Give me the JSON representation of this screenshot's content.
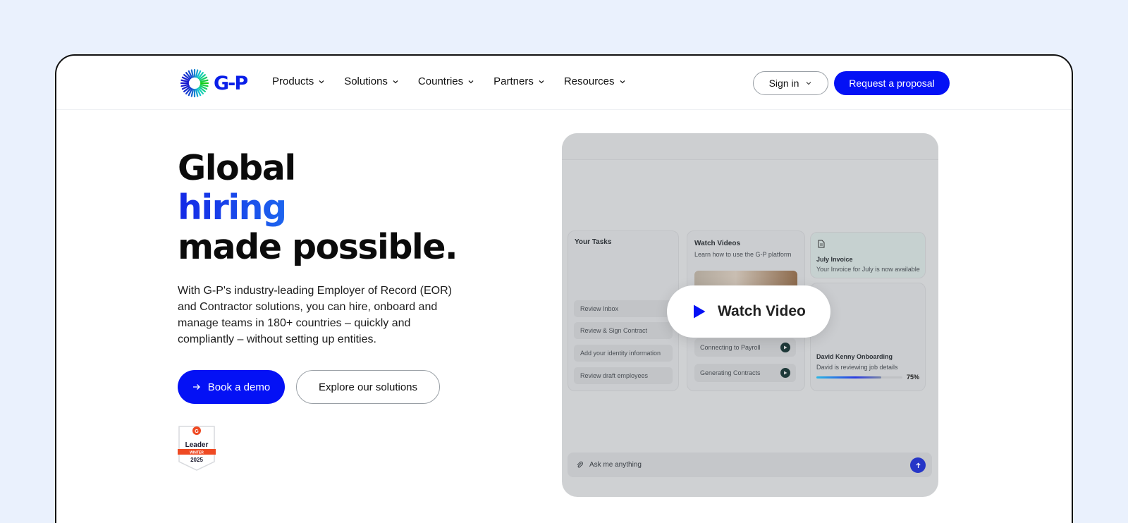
{
  "colors": {
    "brand": "#0411f5",
    "page_bg": "#eaf1fd",
    "text": "#111111"
  },
  "header": {
    "logo_text": "G-P",
    "nav": [
      {
        "label": "Products",
        "icon": "chevron-down-icon"
      },
      {
        "label": "Solutions",
        "icon": "chevron-down-icon"
      },
      {
        "label": "Countries",
        "icon": "chevron-down-icon"
      },
      {
        "label": "Partners",
        "icon": "chevron-down-icon"
      },
      {
        "label": "Resources",
        "icon": "chevron-down-icon"
      }
    ],
    "sign_in": "Sign in",
    "request_proposal": "Request a proposal"
  },
  "hero": {
    "headline_line1": "Global",
    "headline_line2": "hiring",
    "headline_line3": "made possible.",
    "description": "With G-P's industry-leading Employer of Record (EOR) and Contractor solutions, you can hire, onboard and manage teams in 180+ countries – quickly and compliantly – without setting up entities.",
    "book_demo": "Book a demo",
    "explore": "Explore our solutions",
    "badge": {
      "title": "Leader",
      "season": "WINTER",
      "year": "2025"
    }
  },
  "video_panel": {
    "tasks": {
      "title": "Your Tasks",
      "items": [
        "Review Inbox",
        "Review & Sign Contract",
        "Add your identity information",
        "Review draft employees"
      ]
    },
    "watch_videos": {
      "title": "Watch Videos",
      "subtitle": "Learn how to use the G-P platform",
      "rows": [
        "Connecting to Payroll",
        "Generating Contracts"
      ]
    },
    "invoice": {
      "title": "July Invoice",
      "subtitle": "Your Invoice for July is now available"
    },
    "onboarding": {
      "title": "David Kenny Onboarding",
      "subtitle": "David is reviewing job details",
      "progress_label": "75%",
      "progress": 0.75
    },
    "ask_placeholder": "Ask me anything",
    "watch_video_label": "Watch Video"
  }
}
